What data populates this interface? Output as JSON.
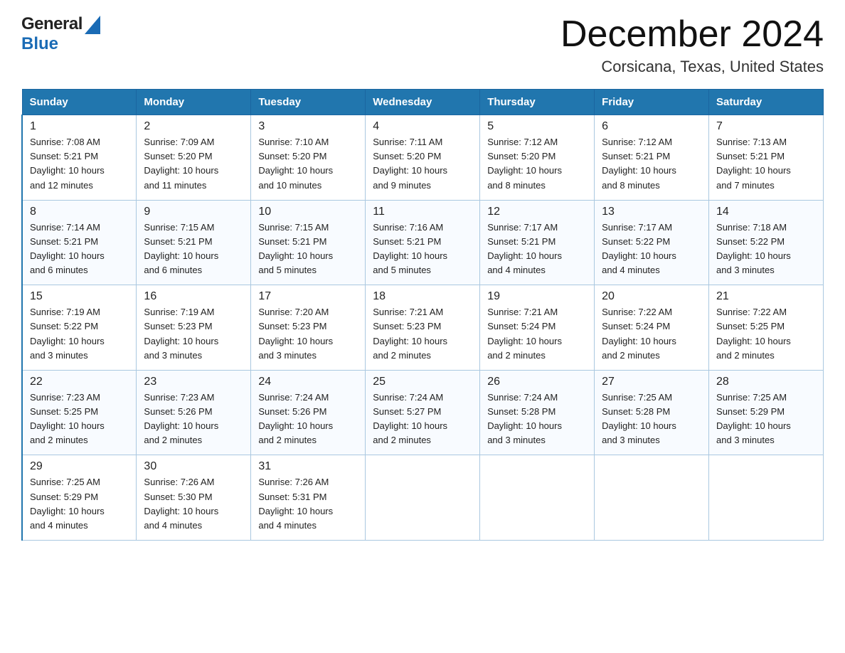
{
  "header": {
    "logo_general": "General",
    "logo_blue": "Blue",
    "month_title": "December 2024",
    "location": "Corsicana, Texas, United States"
  },
  "weekdays": [
    "Sunday",
    "Monday",
    "Tuesday",
    "Wednesday",
    "Thursday",
    "Friday",
    "Saturday"
  ],
  "weeks": [
    [
      {
        "day": "1",
        "sunrise": "7:08 AM",
        "sunset": "5:21 PM",
        "daylight": "10 hours and 12 minutes."
      },
      {
        "day": "2",
        "sunrise": "7:09 AM",
        "sunset": "5:20 PM",
        "daylight": "10 hours and 11 minutes."
      },
      {
        "day": "3",
        "sunrise": "7:10 AM",
        "sunset": "5:20 PM",
        "daylight": "10 hours and 10 minutes."
      },
      {
        "day": "4",
        "sunrise": "7:11 AM",
        "sunset": "5:20 PM",
        "daylight": "10 hours and 9 minutes."
      },
      {
        "day": "5",
        "sunrise": "7:12 AM",
        "sunset": "5:20 PM",
        "daylight": "10 hours and 8 minutes."
      },
      {
        "day": "6",
        "sunrise": "7:12 AM",
        "sunset": "5:21 PM",
        "daylight": "10 hours and 8 minutes."
      },
      {
        "day": "7",
        "sunrise": "7:13 AM",
        "sunset": "5:21 PM",
        "daylight": "10 hours and 7 minutes."
      }
    ],
    [
      {
        "day": "8",
        "sunrise": "7:14 AM",
        "sunset": "5:21 PM",
        "daylight": "10 hours and 6 minutes."
      },
      {
        "day": "9",
        "sunrise": "7:15 AM",
        "sunset": "5:21 PM",
        "daylight": "10 hours and 6 minutes."
      },
      {
        "day": "10",
        "sunrise": "7:15 AM",
        "sunset": "5:21 PM",
        "daylight": "10 hours and 5 minutes."
      },
      {
        "day": "11",
        "sunrise": "7:16 AM",
        "sunset": "5:21 PM",
        "daylight": "10 hours and 5 minutes."
      },
      {
        "day": "12",
        "sunrise": "7:17 AM",
        "sunset": "5:21 PM",
        "daylight": "10 hours and 4 minutes."
      },
      {
        "day": "13",
        "sunrise": "7:17 AM",
        "sunset": "5:22 PM",
        "daylight": "10 hours and 4 minutes."
      },
      {
        "day": "14",
        "sunrise": "7:18 AM",
        "sunset": "5:22 PM",
        "daylight": "10 hours and 3 minutes."
      }
    ],
    [
      {
        "day": "15",
        "sunrise": "7:19 AM",
        "sunset": "5:22 PM",
        "daylight": "10 hours and 3 minutes."
      },
      {
        "day": "16",
        "sunrise": "7:19 AM",
        "sunset": "5:23 PM",
        "daylight": "10 hours and 3 minutes."
      },
      {
        "day": "17",
        "sunrise": "7:20 AM",
        "sunset": "5:23 PM",
        "daylight": "10 hours and 3 minutes."
      },
      {
        "day": "18",
        "sunrise": "7:21 AM",
        "sunset": "5:23 PM",
        "daylight": "10 hours and 2 minutes."
      },
      {
        "day": "19",
        "sunrise": "7:21 AM",
        "sunset": "5:24 PM",
        "daylight": "10 hours and 2 minutes."
      },
      {
        "day": "20",
        "sunrise": "7:22 AM",
        "sunset": "5:24 PM",
        "daylight": "10 hours and 2 minutes."
      },
      {
        "day": "21",
        "sunrise": "7:22 AM",
        "sunset": "5:25 PM",
        "daylight": "10 hours and 2 minutes."
      }
    ],
    [
      {
        "day": "22",
        "sunrise": "7:23 AM",
        "sunset": "5:25 PM",
        "daylight": "10 hours and 2 minutes."
      },
      {
        "day": "23",
        "sunrise": "7:23 AM",
        "sunset": "5:26 PM",
        "daylight": "10 hours and 2 minutes."
      },
      {
        "day": "24",
        "sunrise": "7:24 AM",
        "sunset": "5:26 PM",
        "daylight": "10 hours and 2 minutes."
      },
      {
        "day": "25",
        "sunrise": "7:24 AM",
        "sunset": "5:27 PM",
        "daylight": "10 hours and 2 minutes."
      },
      {
        "day": "26",
        "sunrise": "7:24 AM",
        "sunset": "5:28 PM",
        "daylight": "10 hours and 3 minutes."
      },
      {
        "day": "27",
        "sunrise": "7:25 AM",
        "sunset": "5:28 PM",
        "daylight": "10 hours and 3 minutes."
      },
      {
        "day": "28",
        "sunrise": "7:25 AM",
        "sunset": "5:29 PM",
        "daylight": "10 hours and 3 minutes."
      }
    ],
    [
      {
        "day": "29",
        "sunrise": "7:25 AM",
        "sunset": "5:29 PM",
        "daylight": "10 hours and 4 minutes."
      },
      {
        "day": "30",
        "sunrise": "7:26 AM",
        "sunset": "5:30 PM",
        "daylight": "10 hours and 4 minutes."
      },
      {
        "day": "31",
        "sunrise": "7:26 AM",
        "sunset": "5:31 PM",
        "daylight": "10 hours and 4 minutes."
      },
      null,
      null,
      null,
      null
    ]
  ],
  "labels": {
    "sunrise": "Sunrise:",
    "sunset": "Sunset:",
    "daylight": "Daylight:"
  }
}
